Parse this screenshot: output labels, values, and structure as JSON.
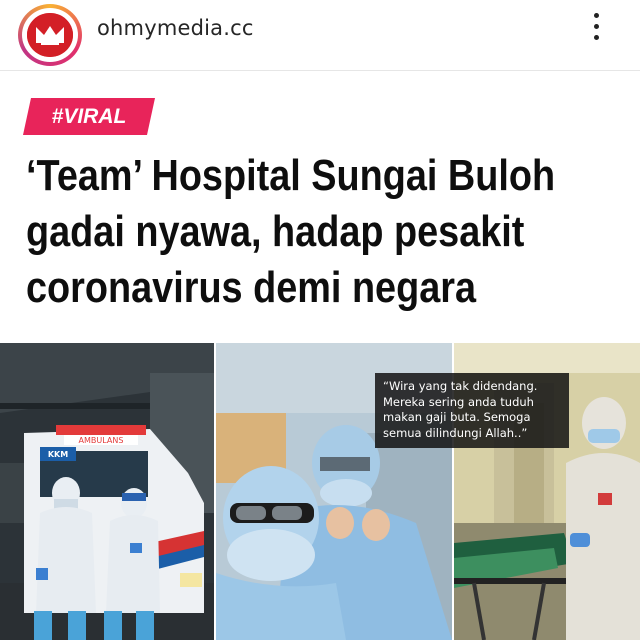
{
  "header": {
    "username": "ohmymedia.cc",
    "avatar_icon": "ohmymedia-logo-icon",
    "more_icon": "more-vertical-icon"
  },
  "post": {
    "tag": "#VIRAL",
    "headline_lines": [
      "‘Team’ Hospital Sungai Buloh",
      "gadai nyawa, hadap pesakit",
      "coronavirus demi negara"
    ],
    "ambulance_text": "AMBULANS",
    "ambulance_badge": "KKM",
    "quote_lines": [
      "“Wira yang tak didendang.",
      "Mereka sering anda tuduh",
      "makan gaji buta. Semoga",
      "semua dilindungi Allah..”"
    ]
  },
  "colors": {
    "tag_background": "#e8245a",
    "headline": "#0e0e0e",
    "ppe_blue": "#9fc9e8",
    "brand_red": "#d31f26"
  }
}
